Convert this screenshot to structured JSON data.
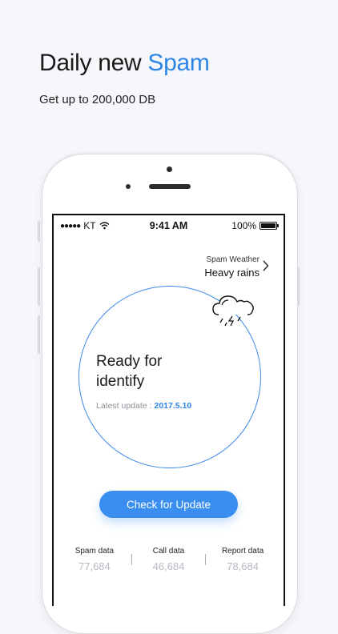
{
  "headline": {
    "prefix": "Daily new ",
    "accent": "Spam"
  },
  "subhead": "Get up to 200,000 DB",
  "status_bar": {
    "dots": "●●●●●",
    "carrier": "KT",
    "time": "9:41 AM",
    "battery": "100%"
  },
  "weather": {
    "label": "Spam Weather",
    "value": "Heavy rains",
    "icon": "rain-cloud-icon"
  },
  "status_card": {
    "line1": "Ready for",
    "line2": "identify",
    "latest_label": "Latest update :",
    "latest_date": "2017.5.10"
  },
  "update_button": "Check for Update",
  "stats": [
    {
      "label": "Spam data",
      "value": "77,684"
    },
    {
      "label": "Call data",
      "value": "46,684"
    },
    {
      "label": "Report data",
      "value": "78,684"
    }
  ],
  "colors": {
    "accent": "#2f86e6",
    "button": "#3a8ef0"
  }
}
